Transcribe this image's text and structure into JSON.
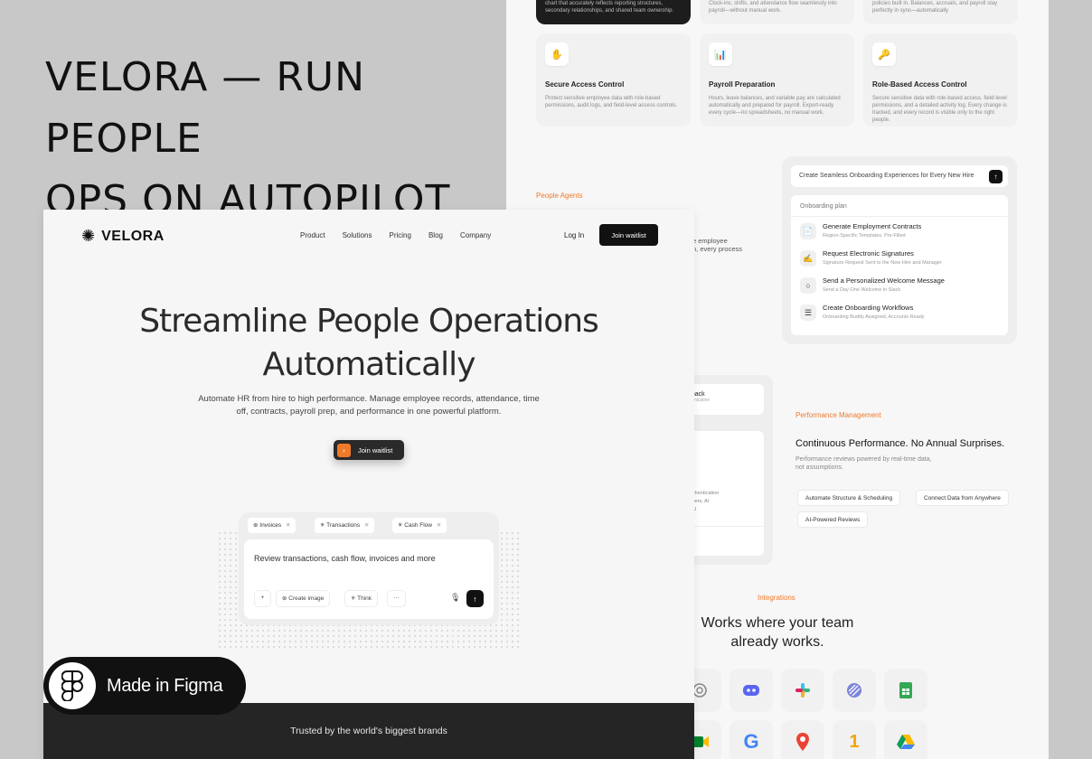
{
  "headline": [
    "VELORA — RUN PEOPLE",
    "OPS ON AUTOPILOT"
  ],
  "board": {
    "top_cards": [
      {
        "desc": "chart that accurately reflects reporting structures, secondary relationships, and shared team ownership."
      },
      {
        "desc": "Clock-ins, shifts, and attendance flow seamlessly into payroll—without manual work."
      },
      {
        "desc": "policies built in. Balances, accruals, and payroll stay perfectly in sync—automatically"
      }
    ],
    "features": [
      {
        "icon": "✋",
        "title": "Secure Access Control",
        "desc": "Protect sensitive employee data with role-based permissions, audit logs, and field-level access controls."
      },
      {
        "icon": "📊",
        "title": "Payroll Preparation",
        "desc": "Hours, leave balances, and variable pay are calculated automatically and prepared for payroll. Export-ready every cycle—no spreadsheets, no manual work."
      },
      {
        "icon": "🔑",
        "title": "Role-Based Access Control",
        "desc": "Secure sensitive data with role-based access, field-level permissions, and a detailed activity log. Every change is tracked, and every record is visible only to the right people."
      }
    ],
    "people_agents_label": "People Agents",
    "people_agents_fragment": [
      "e employee",
      "n, every process"
    ],
    "onboarding": {
      "prompt": "Create Seamless Onboarding Experiences for Every New Hire",
      "send": "↑",
      "plan_label": "Onboarding plan",
      "items": [
        {
          "icon": "📄",
          "title": "Generate Employment Contracts",
          "sub": "Region-Specific Templates, Pre-Filled"
        },
        {
          "icon": "✍",
          "title": "Request Electronic Signatures",
          "sub": "Signature Request Sent to the New Hire and Manager"
        },
        {
          "icon": "○",
          "title": "Send a Personalized Welcome Message",
          "sub": "Send a Day-One Welcome in Slack"
        },
        {
          "icon": "☰",
          "title": "Create Onboarding Workflows",
          "sub": "Onboarding Buddy Assigned, Accounts Ready"
        }
      ]
    },
    "pm_fragments": {
      "feedback": "dback",
      "feedback_sub": "munication",
      "auth": "authentication",
      "auth2": "mbers, AI",
      "auth3": "s AI"
    },
    "performance": {
      "label": "Performance Management",
      "title": "Continuous Performance. No Annual Surprises.",
      "desc": [
        "Performance reviews powered by real-time data,",
        "not assumptions."
      ],
      "tags": [
        "Automate Structure & Scheduling",
        "Connect Data from Anywhere",
        "AI-Powered Reviews"
      ]
    },
    "integrations": {
      "label": "Integrations",
      "title": [
        "Works where your team",
        "already works."
      ],
      "logos": [
        "openai",
        "discord",
        "slack",
        "linear",
        "google-sheets",
        "google-meet",
        "google",
        "google-maps",
        "1password",
        "google-drive"
      ]
    }
  },
  "site": {
    "brand": "VELORA",
    "nav": [
      "Product",
      "Solutions",
      "Pricing",
      "Blog",
      "Company"
    ],
    "login": "Log In",
    "cta": "Join waitlist",
    "hero_title": [
      "Streamline People Operations",
      "Automatically"
    ],
    "hero_sub": "Automate HR from hire to high performance. Manage employee records, attendance, time off, contracts, payroll prep, and performance in one powerful platform.",
    "hero_button": "Join waitlist",
    "chips": [
      "Invoices",
      "Transactions",
      "Cash Flow"
    ],
    "chat_prompt": "Review transactions, cash flow, invoices and more",
    "tools": [
      "Create image",
      "Think"
    ],
    "trusted": "Trusted by the world's biggest brands"
  },
  "badge": "Made in Figma",
  "colors": {
    "accent": "#f07a2a",
    "dark": "#111111"
  }
}
